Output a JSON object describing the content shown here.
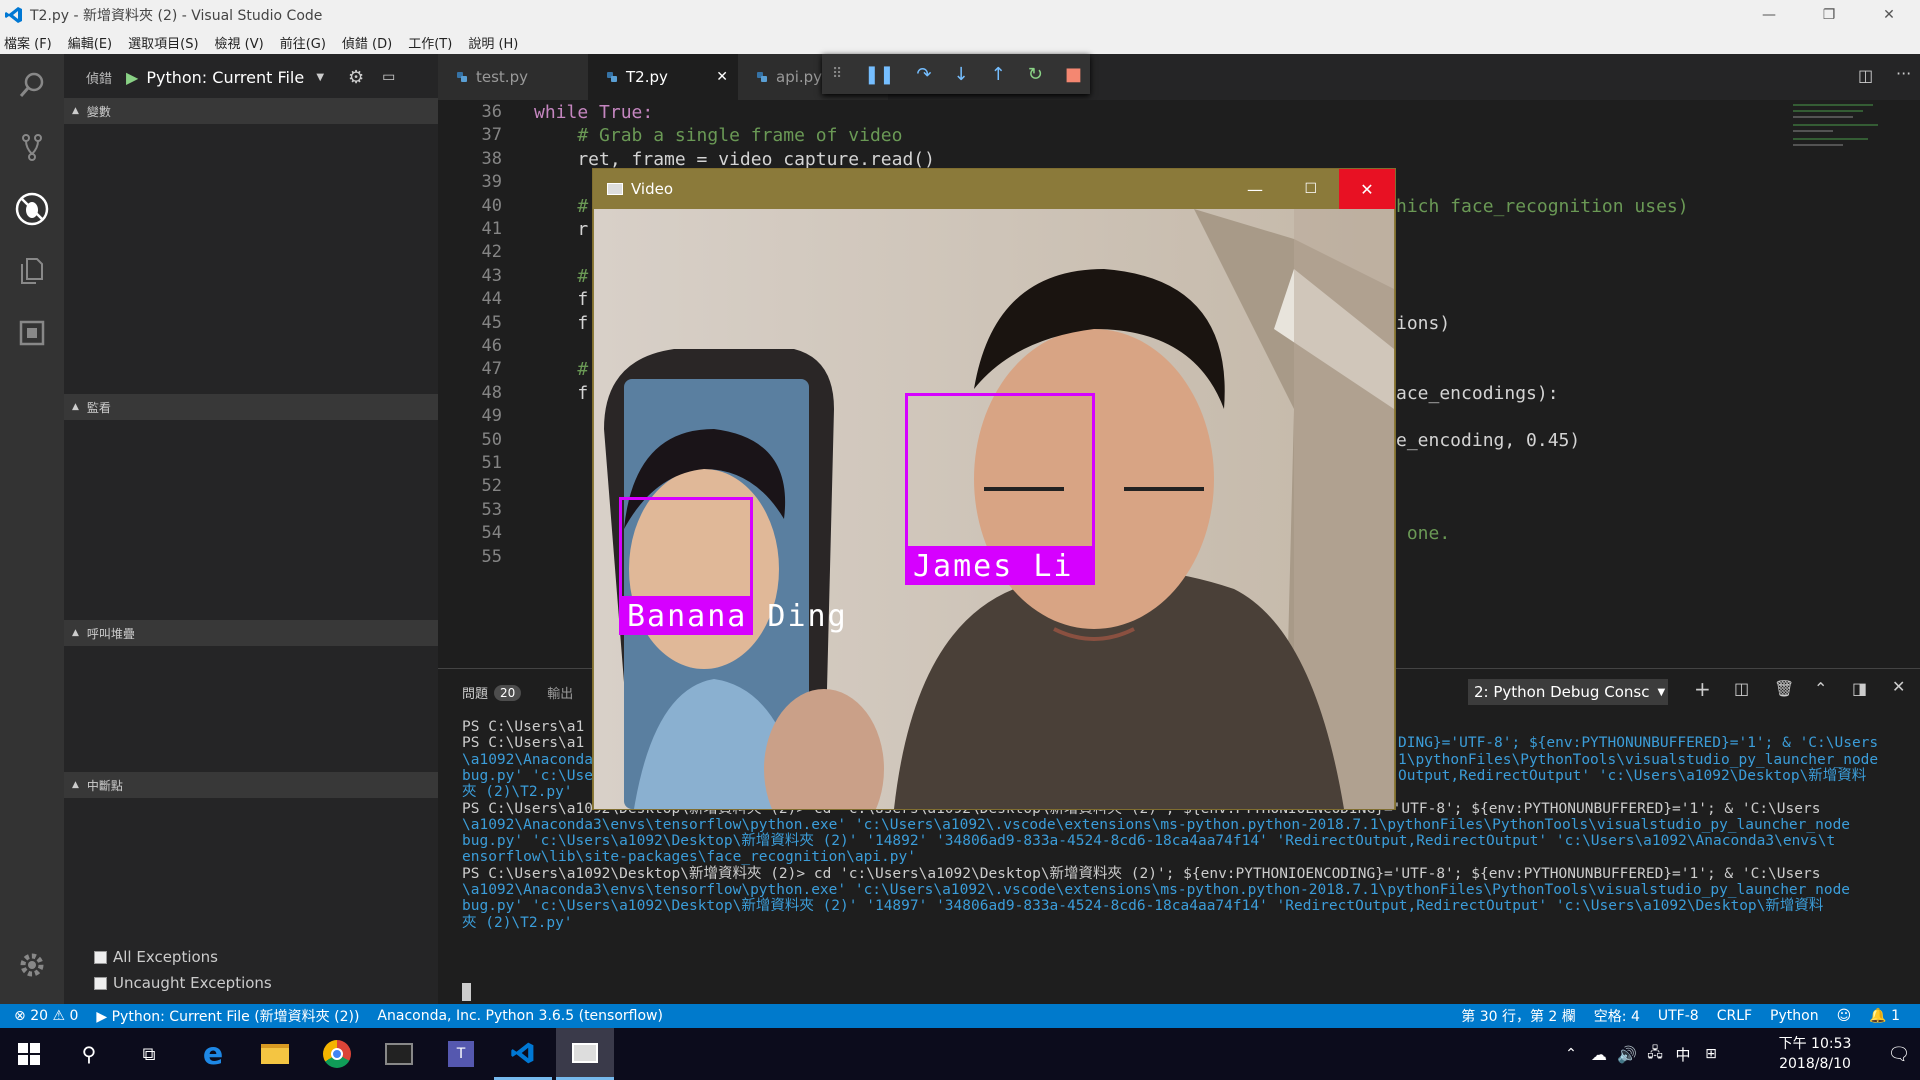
{
  "window": {
    "title": "T2.py - 新增資料夾 (2) - Visual Studio Code",
    "min": "—",
    "restore": "❐",
    "close": "✕"
  },
  "menu": [
    "檔案 (F)",
    "編輯(E)",
    "選取項目(S)",
    "檢視 (V)",
    "前往(G)",
    "偵錯 (D)",
    "工作(T)",
    "說明 (H)"
  ],
  "debug_toolbar": {
    "label": "偵錯",
    "config": "Python: Current File"
  },
  "tabs": [
    {
      "label": "test.py",
      "active": false
    },
    {
      "label": "T2.py",
      "active": true
    },
    {
      "label": "api.py",
      "active": false
    }
  ],
  "sidebar": {
    "variables": "變數",
    "watch": "監看",
    "callstack": "呼叫堆疊",
    "breakpoints": "中斷點",
    "bp_items": [
      "All Exceptions",
      "Uncaught Exceptions"
    ]
  },
  "editor": {
    "lines": [
      {
        "n": "36",
        "t": "while True:"
      },
      {
        "n": "37",
        "t": "    # Grab a single frame of video"
      },
      {
        "n": "38",
        "t": "    ret, frame = video_capture.read()"
      },
      {
        "n": "39",
        "t": ""
      },
      {
        "n": "40",
        "t": "    #"
      },
      {
        "n": "41",
        "t": "    r"
      },
      {
        "n": "42",
        "t": ""
      },
      {
        "n": "43",
        "t": "    #"
      },
      {
        "n": "44",
        "t": "    f"
      },
      {
        "n": "45",
        "t": "    f"
      },
      {
        "n": "46",
        "t": ""
      },
      {
        "n": "47",
        "t": "    #"
      },
      {
        "n": "48",
        "t": "    f"
      },
      {
        "n": "49",
        "t": ""
      },
      {
        "n": "50",
        "t": ""
      },
      {
        "n": "51",
        "t": ""
      },
      {
        "n": "52",
        "t": ""
      },
      {
        "n": "53",
        "t": ""
      },
      {
        "n": "54",
        "t": ""
      },
      {
        "n": "55",
        "t": ""
      }
    ],
    "right_fragments": [
      {
        "line": "40",
        "t": "hich face_recognition uses)"
      },
      {
        "line": "45",
        "t": "ions)"
      },
      {
        "line": "48",
        "t": "ace_encodings):"
      },
      {
        "line": "50",
        "t": "e_encoding, 0.45)"
      },
      {
        "line": "54",
        "t": " one."
      }
    ]
  },
  "panel": {
    "problems_label": "問題",
    "problems_count": "20",
    "output_label": "輸出",
    "terminal_select": "2: Python Debug Consc",
    "lines": [
      "PS C:\\Users\\a1",
      "PS C:\\Users\\a1",
      "\\a1092\\Anaconda",
      "bug.py' 'c:\\Use",
      "夾 (2)\\T2.py'",
      "PS C:\\Users\\a1092\\Desktop\\新增資料夾 (2)> cd 'c:\\Users\\a1092\\Desktop\\新增資料夾 (2)'; ${env:PYTHONIOENCODING}='UTF-8'; ${env:PYTHONUNBUFFERED}='1'; & 'C:\\Users",
      "\\a1092\\Anaconda3\\envs\\tensorflow\\python.exe' 'c:\\Users\\a1092\\.vscode\\extensions\\ms-python.python-2018.7.1\\pythonFiles\\PythonTools\\visualstudio_py_launcher_node",
      "bug.py' 'c:\\Users\\a1092\\Desktop\\新增資料夾 (2)' '14892' '34806ad9-833a-4524-8cd6-18ca4aa74f14' 'RedirectOutput,RedirectOutput' 'c:\\Users\\a1092\\Anaconda3\\envs\\t",
      "ensorflow\\lib\\site-packages\\face_recognition\\api.py'",
      "PS C:\\Users\\a1092\\Desktop\\新增資料夾 (2)> cd 'c:\\Users\\a1092\\Desktop\\新增資料夾 (2)'; ${env:PYTHONIOENCODING}='UTF-8'; ${env:PYTHONUNBUFFERED}='1'; & 'C:\\Users",
      "\\a1092\\Anaconda3\\envs\\tensorflow\\python.exe' 'c:\\Users\\a1092\\.vscode\\extensions\\ms-python.python-2018.7.1\\pythonFiles\\PythonTools\\visualstudio_py_launcher_node",
      "bug.py' 'c:\\Users\\a1092\\Desktop\\新增資料夾 (2)' '14897' '34806ad9-833a-4524-8cd6-18ca4aa74f14' 'RedirectOutput,RedirectOutput' 'c:\\Users\\a1092\\Desktop\\新增資料",
      "夾 (2)\\T2.py'"
    ],
    "right_fragments": [
      "DING}='UTF-8'; ${env:PYTHONUNBUFFERED}='1'; & 'C:\\Users",
      "1\\pythonFiles\\PythonTools\\visualstudio_py_launcher_node",
      "Output,RedirectOutput' 'c:\\Users\\a1092\\Desktop\\新增資料"
    ]
  },
  "status": {
    "errors": "20",
    "warnings": "0",
    "run": "Python: Current File (新增資料夾 (2))",
    "interpreter": "Anaconda, Inc. Python 3.6.5 (tensorflow)",
    "position": "第 30 行，第 2 欄",
    "spaces": "空格: 4",
    "encoding": "UTF-8",
    "eol": "CRLF",
    "language": "Python",
    "notifications": "1"
  },
  "video": {
    "title": "Video",
    "faces": [
      {
        "name": "Banana Ding"
      },
      {
        "name": "James Li"
      }
    ]
  },
  "taskbar": {
    "time": "下午 10:53",
    "date": "2018/8/10",
    "ime": "中"
  },
  "colors": {
    "accent": "#007acc",
    "face_box": "#d600ff",
    "video_title_bg": "#8b7a3a",
    "close_red": "#e81123"
  }
}
